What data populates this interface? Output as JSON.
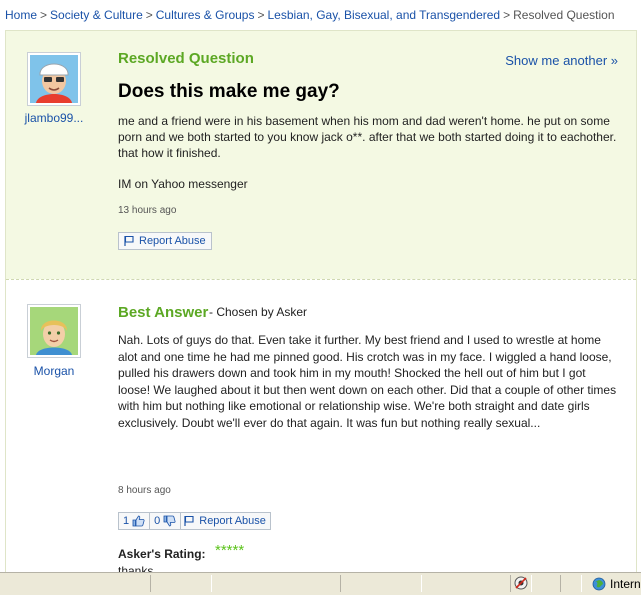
{
  "breadcrumb": {
    "items": [
      "Home",
      "Society & Culture",
      "Cultures & Groups",
      "Lesbian, Gay, Bisexual, and Transgendered"
    ],
    "separator": ">",
    "current": "Resolved Question"
  },
  "question": {
    "status_label": "Resolved Question",
    "show_another": "Show me another »",
    "title": "Does this make me gay?",
    "body": "me and a friend were in his basement when his mom and dad weren't home. he put on some porn and we both started to you know jack o**. after that we both started doing it to eachother. that how it finished.",
    "im_line": "IM on Yahoo messenger",
    "time": "13 hours ago",
    "report_label": "Report Abuse",
    "username": "jlambo99..."
  },
  "answer": {
    "heading": "Best Answer",
    "chosen_by": "- Chosen by Asker",
    "username": "Morgan",
    "body": "Nah. Lots of guys do that. Even take it further. My best friend and I used to wrestle at home alot and one time he had me pinned good. His crotch was in my face. I wiggled a hand loose, pulled his drawers down and took him in my mouth! Shocked the hell out of him but I got loose! We laughed about it but then went down on each other. Did that a couple of other times with him but nothing like emotional or relationship wise. We're both straight and date girls exclusively. Doubt we'll ever do that again. It was fun but nothing really sexual...",
    "time": "8 hours ago",
    "thumbs_up_count": "1",
    "thumbs_down_count": "0",
    "report_label": "Report Abuse",
    "rating_label": "Asker's Rating:",
    "rating_stars": "*****",
    "rating_value": 5,
    "rating_comment": "thanks"
  },
  "statusbar": {
    "zone": "Intern"
  },
  "colors": {
    "link": "#1a52a8",
    "green": "#5ca824",
    "star": "#5ec41e",
    "question_bg": "#f4f9e3"
  }
}
